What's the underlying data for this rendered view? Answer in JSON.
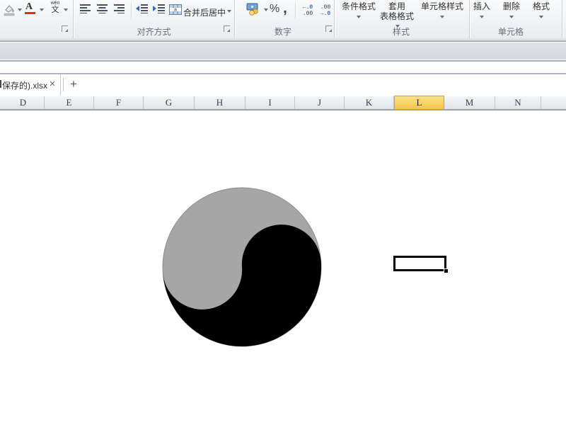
{
  "ribbon": {
    "font_group": {
      "font_color_letter": "A",
      "phonetic_top": "wén",
      "phonetic_char": "文"
    },
    "alignment_group": {
      "label": "对齐方式",
      "merge_center_label": "合并后居中"
    },
    "number_group": {
      "label": "数字",
      "percent": "%",
      "comma": ",",
      "increase_decimal_top": "←.0",
      "increase_decimal_bottom": ".00",
      "decrease_decimal_top": ".00",
      "decrease_decimal_bottom": "→.0"
    },
    "styles_group": {
      "label": "样式",
      "conditional_formatting": "条件格式",
      "format_as_table_line1": "套用",
      "format_as_table_line2": "表格格式",
      "cell_styles": "单元格样式"
    },
    "cells_group": {
      "label": "单元格",
      "insert": "插入",
      "delete": "删除",
      "format": "格式"
    }
  },
  "tabbar": {
    "active_tab_label": "保存的).xlsx",
    "close_glyph": "✕",
    "new_tab_glyph": "+"
  },
  "sheet": {
    "columns": [
      "D",
      "E",
      "F",
      "G",
      "H",
      "I",
      "J",
      "K",
      "L",
      "M",
      "N"
    ],
    "selected_column": "L"
  },
  "shape": {
    "type": "yin-yang",
    "gray_color": "#a6a6a6",
    "black_color": "#000000"
  },
  "colors": {
    "selected_header_border": "#dd9c39",
    "selected_header_top": "#fbe184",
    "selected_header_bottom": "#f5c54e",
    "accent_blue": "#3e66b0",
    "font_color_bar": "#e03000",
    "fill_color_bar": "#c0c0c0"
  }
}
